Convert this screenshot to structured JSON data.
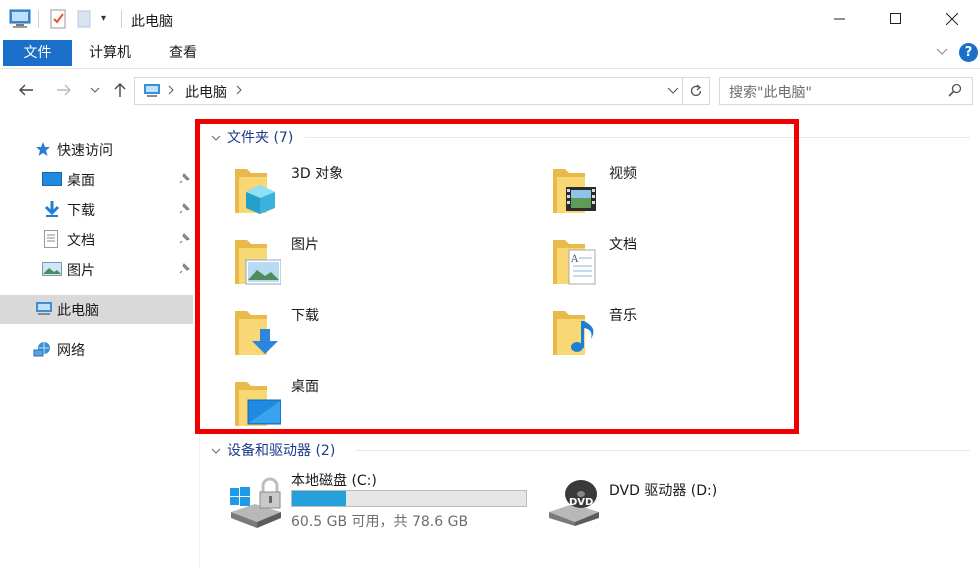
{
  "window": {
    "title": "此电脑"
  },
  "ribbon": {
    "tabs": [
      "文件",
      "计算机",
      "查看"
    ],
    "help": "?"
  },
  "nav": {
    "address": "此电脑",
    "search_placeholder": "搜索\"此电脑\""
  },
  "sidebar": {
    "quick_access": "快速访问",
    "items": [
      "桌面",
      "下载",
      "文档",
      "图片"
    ],
    "this_pc": "此电脑",
    "network": "网络"
  },
  "folders_group": {
    "header": "文件夹 (7)",
    "items": [
      "3D 对象",
      "视频",
      "图片",
      "文档",
      "下载",
      "音乐",
      "桌面"
    ]
  },
  "devices_group": {
    "header": "设备和驱动器 (2)",
    "drives": [
      {
        "name": "本地磁盘 (C:)",
        "info": "60.5 GB 可用，共 78.6 GB",
        "used_fraction": 0.23
      },
      {
        "name": "DVD 驱动器 (D:)"
      }
    ]
  },
  "colors": {
    "accent": "#1a6fc8",
    "highlight_border": "#f00000",
    "usage_fill": "#26a0da",
    "folder_yellow": "#f8d775"
  }
}
